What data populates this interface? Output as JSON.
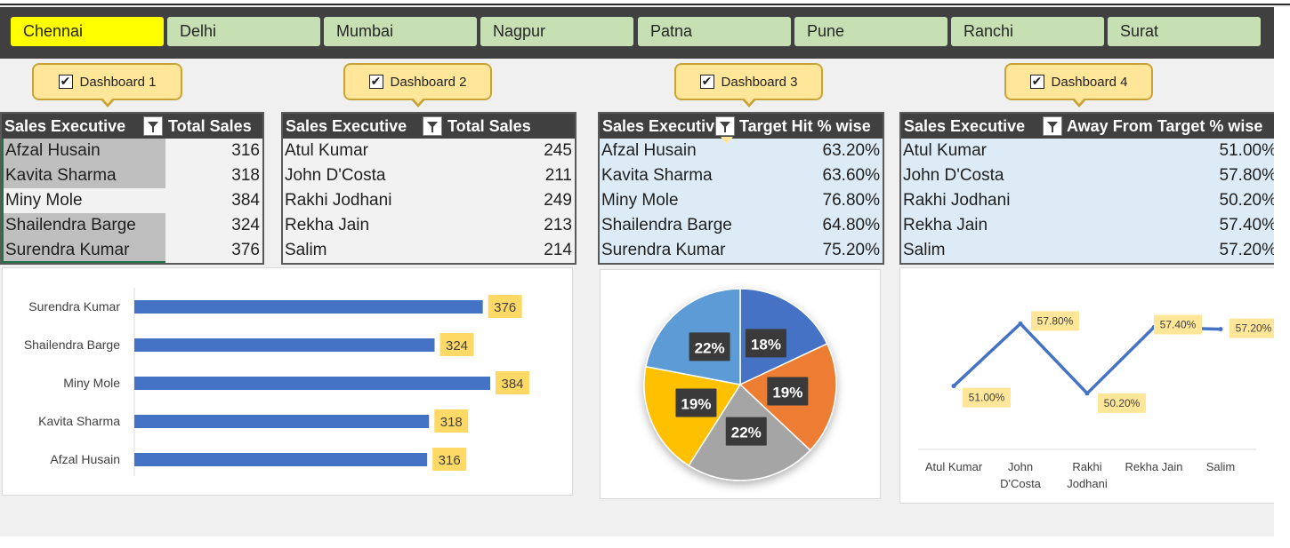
{
  "cities": [
    "Chennai",
    "Delhi",
    "Mumbai",
    "Nagpur",
    "Patna",
    "Pune",
    "Ranchi",
    "Surat"
  ],
  "selected_city": "Chennai",
  "dashboards": [
    {
      "label": "Dashboard 1",
      "checked": "✔"
    },
    {
      "label": "Dashboard 2",
      "checked": "✔"
    },
    {
      "label": "Dashboard 3",
      "checked": "✔"
    },
    {
      "label": "Dashboard 4",
      "checked": "✔"
    }
  ],
  "tables": [
    {
      "col1": "Sales Executive",
      "col2": "Total Sales",
      "rows": [
        {
          "name": "Afzal Husain",
          "value": "316"
        },
        {
          "name": "Kavita Sharma",
          "value": "318"
        },
        {
          "name": "Miny Mole",
          "value": "384"
        },
        {
          "name": "Shailendra Barge",
          "value": "324"
        },
        {
          "name": "Surendra Kumar",
          "value": "376"
        }
      ]
    },
    {
      "col1": "Sales Executive",
      "col2": "Total Sales",
      "rows": [
        {
          "name": "Atul Kumar",
          "value": "245"
        },
        {
          "name": "John D'Costa",
          "value": "211"
        },
        {
          "name": "Rakhi Jodhani",
          "value": "249"
        },
        {
          "name": "Rekha Jain",
          "value": "213"
        },
        {
          "name": "Salim",
          "value": "214"
        }
      ]
    },
    {
      "col1": "Sales Executive",
      "col2": "Target Hit % wise",
      "rows": [
        {
          "name": "Afzal Husain",
          "value": "63.20%"
        },
        {
          "name": "Kavita Sharma",
          "value": "63.60%"
        },
        {
          "name": "Miny Mole",
          "value": "76.80%"
        },
        {
          "name": "Shailendra Barge",
          "value": "64.80%"
        },
        {
          "name": "Surendra Kumar",
          "value": "75.20%"
        }
      ]
    },
    {
      "col1": "Sales Executive",
      "col2": "Away From Target % wise",
      "rows": [
        {
          "name": "Atul Kumar",
          "value": "51.00%"
        },
        {
          "name": "John D'Costa",
          "value": "57.80%"
        },
        {
          "name": "Rakhi Jodhani",
          "value": "50.20%"
        },
        {
          "name": "Rekha Jain",
          "value": "57.40%"
        },
        {
          "name": "Salim",
          "value": "57.20%"
        }
      ]
    }
  ],
  "colors": {
    "slicer_active": "#ffff00",
    "slicer_inactive": "#c6e0b4",
    "header_dark": "#404040",
    "bar_blue": "#4472c4",
    "label_gold": "#ffd966",
    "table3_bg": "#ddebf7",
    "selected_row": "#bfbfbf"
  },
  "chart_data": [
    {
      "type": "bar",
      "orientation": "horizontal",
      "categories": [
        "Surendra Kumar",
        "Shailendra Barge",
        "Miny Mole",
        "Kavita Sharma",
        "Afzal Husain"
      ],
      "values": [
        376,
        324,
        384,
        318,
        316
      ],
      "data_labels": [
        "376",
        "324",
        "384",
        "318",
        "316"
      ],
      "xlim": [
        0,
        420
      ],
      "grid": false
    },
    {
      "type": "pie",
      "values": [
        18,
        19,
        22,
        19,
        22
      ],
      "data_labels": [
        "18%",
        "19%",
        "22%",
        "19%",
        "22%"
      ],
      "slice_colors": [
        "#4472c4",
        "#ed7d31",
        "#a5a5a5",
        "#ffc000",
        "#5b9bd5"
      ]
    },
    {
      "type": "line",
      "categories": [
        "Atul Kumar",
        "John D'Costa",
        "Rakhi Jodhani",
        "Rekha Jain",
        "Salim"
      ],
      "category_lines": [
        [
          "Atul Kumar"
        ],
        [
          "John",
          "D'Costa"
        ],
        [
          "Rakhi",
          "Jodhani"
        ],
        [
          "Rekha Jain"
        ],
        [
          "Salim"
        ]
      ],
      "values": [
        51.0,
        57.8,
        50.2,
        57.4,
        57.2
      ],
      "data_labels": [
        "51.00%",
        "57.80%",
        "50.20%",
        "57.40%",
        "57.20%"
      ],
      "ylim": [
        44,
        59
      ],
      "grid": false
    }
  ]
}
